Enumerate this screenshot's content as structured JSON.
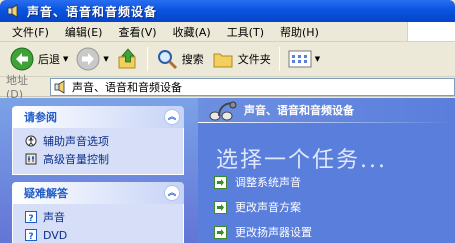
{
  "window": {
    "title": "声音、语音和音频设备"
  },
  "menu": {
    "items": [
      {
        "label": "文件(F)"
      },
      {
        "label": "编辑(E)"
      },
      {
        "label": "查看(V)"
      },
      {
        "label": "收藏(A)"
      },
      {
        "label": "工具(T)"
      },
      {
        "label": "帮助(H)"
      }
    ]
  },
  "toolbar": {
    "back_label": "后退",
    "search_label": "搜索",
    "folders_label": "文件夹"
  },
  "address": {
    "label": "地址(D)",
    "value": "声音、语音和音频设备"
  },
  "sidebar": {
    "see_also": {
      "title": "请参阅",
      "items": [
        {
          "label": "辅助声音选项"
        },
        {
          "label": "高级音量控制"
        }
      ]
    },
    "troubleshoot": {
      "title": "疑难解答",
      "items": [
        {
          "label": "声音"
        },
        {
          "label": "DVD"
        }
      ]
    }
  },
  "main": {
    "header_title": "声音、语音和音频设备",
    "prompt": "选择一个任务...",
    "tasks": [
      {
        "label": "调整系统声音"
      },
      {
        "label": "更改声音方案"
      },
      {
        "label": "更改扬声器设置"
      }
    ]
  },
  "colors": {
    "title_blue": "#0a54e0",
    "sidebar_blue": "#6e8fe0",
    "main_blue": "#5a7edc",
    "task_arrow_green": "#3b8a2e"
  }
}
